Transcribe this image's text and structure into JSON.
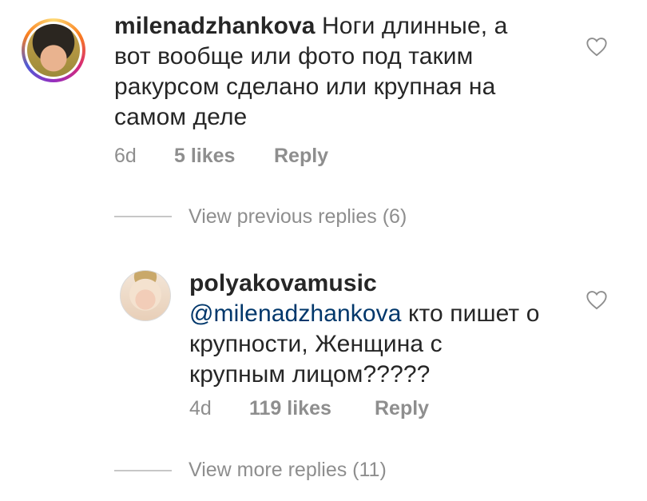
{
  "comments": [
    {
      "username": "milenadzhankova",
      "text": "Ноги длинные, а вот вообще или фото под таким ракурсом сделано или крупная на самом деле",
      "time": "6d",
      "likes": "5 likes",
      "reply": "Reply"
    },
    {
      "username": "polyakovamusic",
      "mention": "@milenadzhankova",
      "text": " кто пишет о крупности, Женщина с крупным лицом?????",
      "time": "4d",
      "likes": "119 likes",
      "reply": "Reply"
    }
  ],
  "view_previous": "View previous replies (6)",
  "view_more": "View more replies (11)",
  "icons": {
    "like": "heart-outline-icon"
  },
  "colors": {
    "text": "#262626",
    "secondary": "#8e8e8e",
    "mention": "#00376b"
  }
}
